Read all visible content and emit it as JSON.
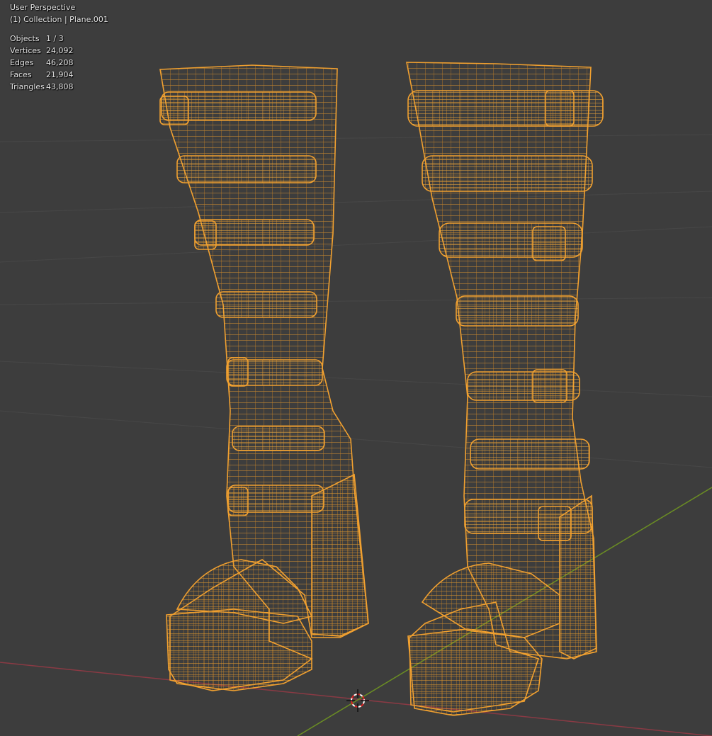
{
  "viewport": {
    "view_name": "User Perspective",
    "collection_line": "(1) Collection | Plane.001",
    "stats": [
      {
        "label": "Objects",
        "value": "1 / 3"
      },
      {
        "label": "Vertices",
        "value": "24,092"
      },
      {
        "label": "Edges",
        "value": "46,208"
      },
      {
        "label": "Faces",
        "value": "21,904"
      },
      {
        "label": "Triangles",
        "value": "43,808"
      }
    ],
    "colors": {
      "background": "#3d3d3d",
      "grid": "#4a4a4a",
      "x_axis": "#8a3a44",
      "y_axis": "#6b8e23",
      "wireframe": "#f0a030"
    }
  }
}
